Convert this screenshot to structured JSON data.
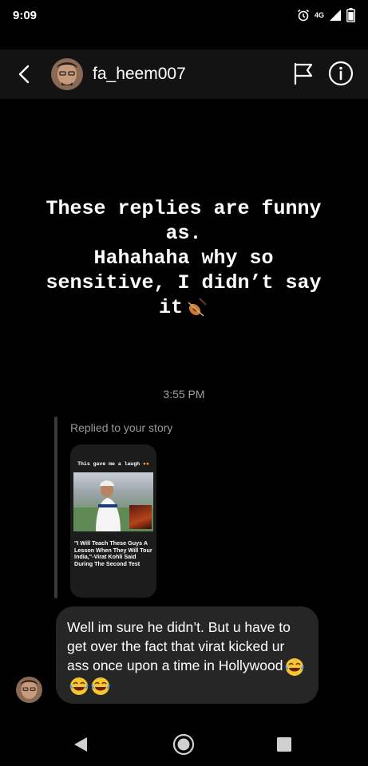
{
  "status_bar": {
    "time": "9:09",
    "network": "4G"
  },
  "header": {
    "username": "fa_heem007"
  },
  "story": {
    "lines": [
      "These replies are funny",
      "as.",
      "Hahahaha why so",
      "sensitive, I didn’t say",
      "it"
    ]
  },
  "timestamp": "3:55 PM",
  "reply": {
    "label": "Replied to your story",
    "thumb_caption": "This gave me a laugh",
    "thumb_headline": "\"I Will Teach These Guys A Lesson When They Will Tour India,\"-Virat Kohli Said During The Second Test"
  },
  "message": {
    "text": "Well im sure he didn’t. But u have to get over the fact that virat kicked ur ass once upon a time in Hollywood"
  },
  "icons": [
    "back-icon",
    "flag-icon",
    "info-icon",
    "alarm-icon",
    "signal-icon",
    "battery-icon",
    "violin-emoji",
    "laughing-emoji"
  ]
}
